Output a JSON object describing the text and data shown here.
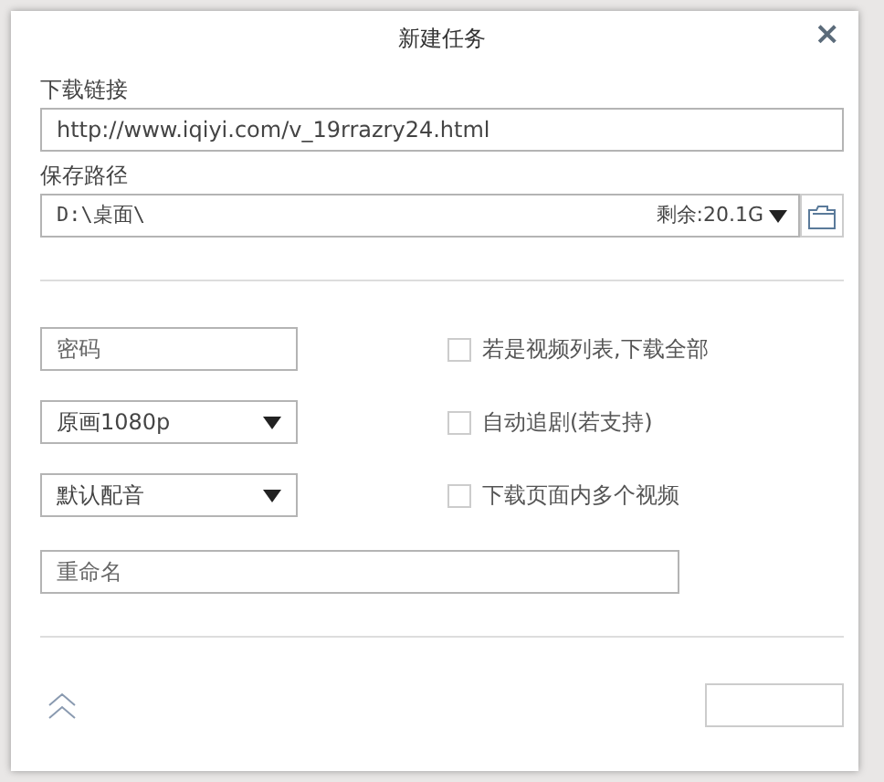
{
  "dialog": {
    "title": "新建任务",
    "close": "×"
  },
  "url": {
    "label": "下载链接",
    "value": "http://www.iqiyi.com/v_19rrazry24.html"
  },
  "save_path": {
    "label": "保存路径",
    "value": "D:\\桌面\\",
    "free_space": "剩余:20.1G"
  },
  "fields": [
    {
      "kind": "input",
      "placeholder": "密码"
    },
    {
      "kind": "select",
      "value": "原画1080p"
    },
    {
      "kind": "select",
      "value": "默认配音"
    }
  ],
  "options": [
    {
      "label": "若是视频列表,下载全部",
      "checked": false
    },
    {
      "label": "自动追剧(若支持)",
      "checked": false
    },
    {
      "label": "下载页面内多个视频",
      "checked": false
    }
  ],
  "rename": {
    "placeholder": "重命名"
  }
}
